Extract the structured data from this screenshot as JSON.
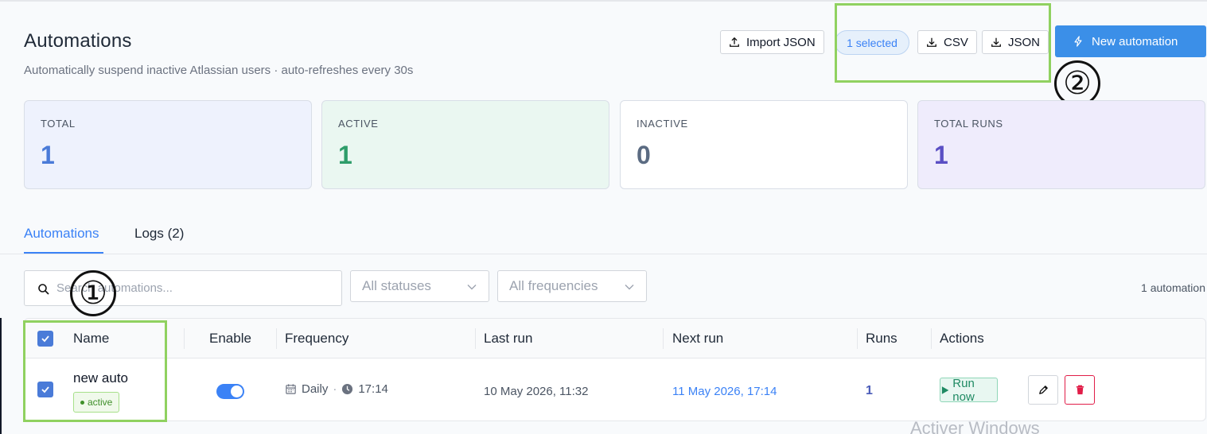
{
  "header": {
    "title": "Automations",
    "subtitle": "Automatically suspend inactive Atlassian users · auto-refreshes every 30s",
    "import_label": "Import JSON",
    "selected_label": "1 selected",
    "csv_label": "CSV",
    "json_label": "JSON",
    "new_label": "New automation"
  },
  "annotations": {
    "one": "①",
    "two": "②"
  },
  "stats": [
    {
      "label": "TOTAL",
      "value": "1"
    },
    {
      "label": "ACTIVE",
      "value": "1"
    },
    {
      "label": "INACTIVE",
      "value": "0"
    },
    {
      "label": "TOTAL RUNS",
      "value": "1"
    }
  ],
  "tabs": [
    {
      "label": "Automations",
      "active": true
    },
    {
      "label": "Logs (2)",
      "active": false
    }
  ],
  "filters": {
    "search_placeholder": "Search automations...",
    "status": "All statuses",
    "frequency": "All frequencies",
    "count": "1 automation"
  },
  "table": {
    "headers": [
      "Name",
      "Enable",
      "Frequency",
      "Last run",
      "Next run",
      "Runs",
      "Actions"
    ],
    "rows": [
      {
        "name": "new auto",
        "status": "active",
        "enabled": true,
        "selected": true,
        "frequency": "Daily",
        "time": "17:14",
        "last_run": "10 May 2026, 11:32",
        "next_run": "11 May 2026, 17:14",
        "runs": "1",
        "run_label": "Run now"
      }
    ]
  },
  "watermark": "Activer Windows",
  "colors": {
    "primary": "#3b8fe8",
    "highlight": "#90d160",
    "stat_total": "#4a7bd8",
    "stat_active": "#2e9d6a",
    "stat_inactive": "#5b6b82",
    "stat_runs": "#5a4fc4",
    "next_run": "#3b82f6",
    "danger": "#e11d48"
  }
}
